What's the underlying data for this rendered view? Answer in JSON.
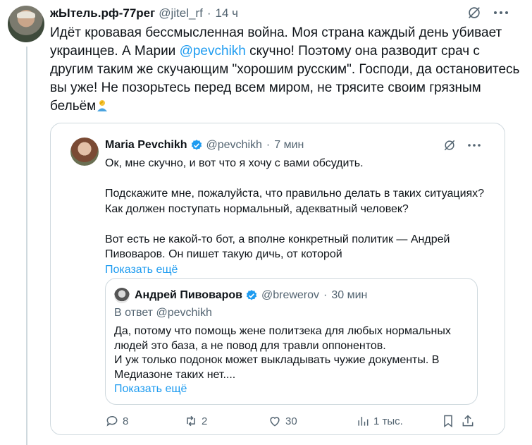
{
  "tweet": {
    "author_name": "жЫтель.рф-77рег",
    "handle": "@jitel_rf",
    "separator": "·",
    "time": "14 ч",
    "text_part1": "Идёт кровавая бессмысленная война. Моя страна каждый день убивает украинцев. А Марии ",
    "mention": "@pevchikh",
    "text_part2": " скучно! Поэтому она разводит срач с другим таким же скучающим \"хорошим русским\". Господи, да остановитесь вы уже! Не позорьтесь перед всем миром, не трясите своим грязным бельём"
  },
  "quote": {
    "author_name": "Maria Pevchikh",
    "handle": "@pevchikh",
    "separator": "·",
    "time": "7 мин",
    "para1": "Ок, мне скучно, и вот что я хочу с вами обсудить.",
    "para2": "Подскажите мне, пожалуйста, что правильно делать в таких ситуациях? Как должен поступать нормальный, адекватный человек?",
    "para3": "Вот есть не какой-то бот, а вполне конкретный политик — Андрей Пивоваров. Он пишет такую дичь, от которой",
    "show_more": "Показать ещё",
    "inner": {
      "author_name": "Андрей Пивоваров",
      "handle": "@brewerov",
      "separator": "·",
      "time": "30 мин",
      "reply_to": "В ответ @pevchikh",
      "text": "Да, потому что помощь жене политзека для любых нормальных людей это база, а не повод для травли оппонентов.\nИ уж только подонок может выкладывать чужие документы. В Медиазоне таких нет....",
      "show_more": "Показать ещё"
    },
    "actions": {
      "replies": "8",
      "reposts": "2",
      "likes": "30",
      "views": "1 тыс."
    }
  },
  "colors": {
    "accent": "#1d9bf0",
    "muted": "#536471",
    "border": "#cfd9de",
    "text": "#0f1419"
  },
  "icons": [
    "grok-icon",
    "more-icon",
    "verified-badge-icon",
    "person-facepalm-emoji",
    "reply-icon",
    "repost-icon",
    "like-icon",
    "views-icon",
    "bookmark-icon",
    "share-icon"
  ]
}
